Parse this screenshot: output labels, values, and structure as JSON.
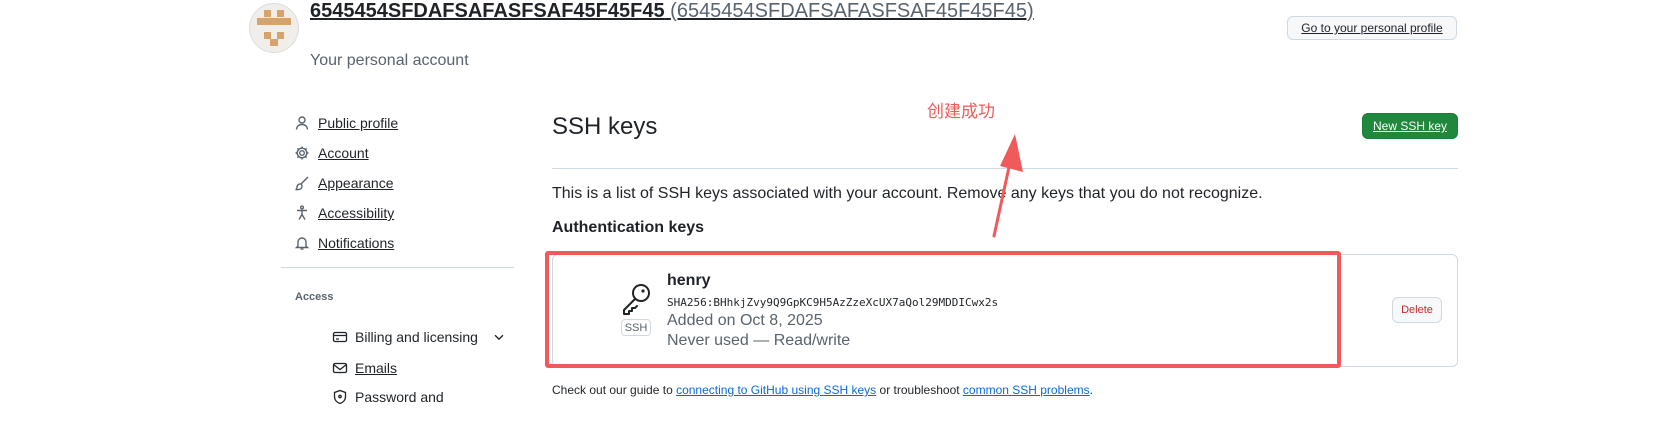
{
  "header": {
    "account_name": "6545454SFDAFSAFASFSAF45F45F45",
    "account_login": "(6545454SFDAFSAFASFSAF45F45F45)",
    "subtitle": "Your personal account",
    "profile_button": "Go to your personal profile"
  },
  "sidebar": {
    "items": [
      {
        "label": "Public profile",
        "icon": "person-icon"
      },
      {
        "label": "Account",
        "icon": "gear-icon"
      },
      {
        "label": "Appearance",
        "icon": "paintbrush-icon"
      },
      {
        "label": "Accessibility",
        "icon": "accessibility-icon"
      },
      {
        "label": "Notifications",
        "icon": "bell-icon"
      }
    ],
    "access_heading": "Access",
    "access_items": [
      {
        "label": "Billing and licensing",
        "icon": "credit-card-icon"
      },
      {
        "label": "Emails",
        "icon": "mail-icon"
      },
      {
        "label": "Password and",
        "icon": "shield-lock-icon"
      }
    ]
  },
  "main": {
    "title": "SSH keys",
    "new_button": "New SSH key",
    "intro": "This is a list of SSH keys associated with your account. Remove any keys that you do not recognize.",
    "auth_heading": "Authentication keys",
    "key": {
      "name": "henry",
      "fingerprint": "SHA256:BHhkjZvy9Q9GpKC9H5AzZzeXcUX7aQol29MDDICwx2s",
      "added": "Added on Oct 8, 2025",
      "usage": "Never used — Read/write",
      "badge": "SSH",
      "delete_button": "Delete"
    },
    "footer": {
      "prefix": "Check out our guide to ",
      "link1": "connecting to GitHub using SSH keys",
      "middle": " or troubleshoot ",
      "link2": "common SSH problems",
      "suffix": "."
    }
  },
  "annotation": {
    "text": "创建成功",
    "color": "#f05a5a"
  },
  "colors": {
    "primary_button": "#1f883d",
    "danger": "#d1242f",
    "link": "#0969da",
    "annotation": "#f05a5a"
  }
}
